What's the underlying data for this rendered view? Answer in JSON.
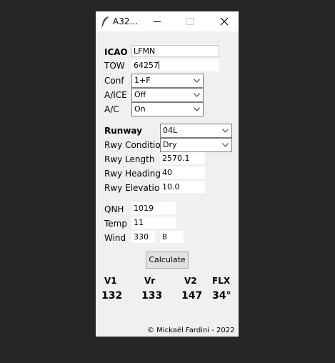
{
  "window": {
    "title": "A32..."
  },
  "form": {
    "icao": {
      "label": "ICAO",
      "value": "LFMN"
    },
    "tow": {
      "label": "TOW",
      "value": "64257"
    },
    "conf": {
      "label": "Conf",
      "value": "1+F"
    },
    "anti_ice": {
      "label": "A/ICE",
      "value": "Off"
    },
    "ac": {
      "label": "A/C",
      "value": "On"
    },
    "runway": {
      "label": "Runway",
      "value": "04L"
    },
    "rwy_condition": {
      "label": "Rwy Condition",
      "value": "Dry"
    },
    "rwy_length": {
      "label": "Rwy Length",
      "value": "2570.1"
    },
    "rwy_heading": {
      "label": "Rwy Heading",
      "value": "40"
    },
    "rwy_elevation": {
      "label": "Rwy Elevation",
      "value": "10.0"
    },
    "qnh": {
      "label": "QNH",
      "value": "1019"
    },
    "temp": {
      "label": "Temp",
      "value": "11"
    },
    "wind": {
      "label": "Wind",
      "direction": "330",
      "speed": "8"
    }
  },
  "calculate_label": "Calculate",
  "results": {
    "v1": {
      "label": "V1",
      "value": "132"
    },
    "vr": {
      "label": "Vr",
      "value": "133"
    },
    "v2": {
      "label": "V2",
      "value": "147"
    },
    "flx": {
      "label": "FLX",
      "value": "34°"
    }
  },
  "footer": {
    "copyright": "© Mickaël Fardini - 2022"
  },
  "colors": {
    "background": "#252525",
    "window": "#f0f0f0",
    "titlebar": "#ffffff"
  }
}
